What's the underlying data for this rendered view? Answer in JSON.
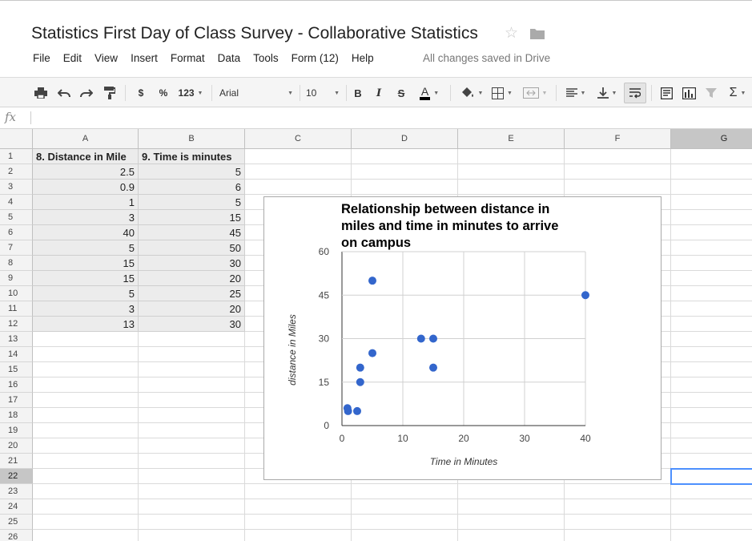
{
  "document": {
    "title": "Statistics First Day of Class Survey - Collaborative Statistics",
    "star_icon": "star-outline-icon",
    "folder_icon": "folder-icon",
    "save_status": "All changes saved in Drive"
  },
  "menu": [
    "File",
    "Edit",
    "View",
    "Insert",
    "Format",
    "Data",
    "Tools",
    "Form (12)",
    "Help"
  ],
  "toolbar": {
    "currency": "$",
    "percent": "%",
    "number_format": "123",
    "font": "Arial",
    "font_size": "10",
    "bold": "B",
    "italic": "I",
    "strikethrough": "S",
    "text_color_letter": "A"
  },
  "formula_bar": {
    "label": "fx",
    "value": ""
  },
  "sheet": {
    "columns": [
      "A",
      "B",
      "C",
      "D",
      "E",
      "F",
      "G"
    ],
    "rows": [
      "1",
      "2",
      "3",
      "4",
      "5",
      "6",
      "7",
      "8",
      "9",
      "10",
      "11",
      "12",
      "13",
      "14",
      "15",
      "16",
      "17",
      "18",
      "19",
      "20",
      "21",
      "22",
      "23",
      "24",
      "25",
      "26"
    ],
    "selected_row": "22",
    "selected_column": "G",
    "headers": [
      "8. Distance in Mile",
      "9. Time is minutes"
    ],
    "data": [
      [
        "2.5",
        "5"
      ],
      [
        "0.9",
        "6"
      ],
      [
        "1",
        "5"
      ],
      [
        "3",
        "15"
      ],
      [
        "40",
        "45"
      ],
      [
        "5",
        "50"
      ],
      [
        "15",
        "30"
      ],
      [
        "15",
        "20"
      ],
      [
        "5",
        "25"
      ],
      [
        "3",
        "20"
      ],
      [
        "13",
        "30"
      ]
    ]
  },
  "chart_data": {
    "type": "scatter",
    "title": "Relationship between distance in miles and time in minutes to arrive on campus",
    "title_lines": [
      "Relationship between distance in",
      "miles and time in minutes to arrive",
      "on campus"
    ],
    "xlabel": "Time in Minutes",
    "ylabel": "distance in Miles",
    "xlim": [
      0,
      40
    ],
    "ylim": [
      0,
      60
    ],
    "xticks": [
      "0",
      "10",
      "20",
      "30",
      "40"
    ],
    "yticks": [
      "0",
      "15",
      "30",
      "45",
      "60"
    ],
    "grid": true,
    "legend": "none",
    "point_color": "#3366cc",
    "points": [
      {
        "x": 2.5,
        "y": 5
      },
      {
        "x": 0.9,
        "y": 6
      },
      {
        "x": 1,
        "y": 5
      },
      {
        "x": 3,
        "y": 15
      },
      {
        "x": 40,
        "y": 45
      },
      {
        "x": 5,
        "y": 50
      },
      {
        "x": 15,
        "y": 30
      },
      {
        "x": 15,
        "y": 20
      },
      {
        "x": 5,
        "y": 25
      },
      {
        "x": 3,
        "y": 20
      },
      {
        "x": 13,
        "y": 30
      }
    ]
  }
}
